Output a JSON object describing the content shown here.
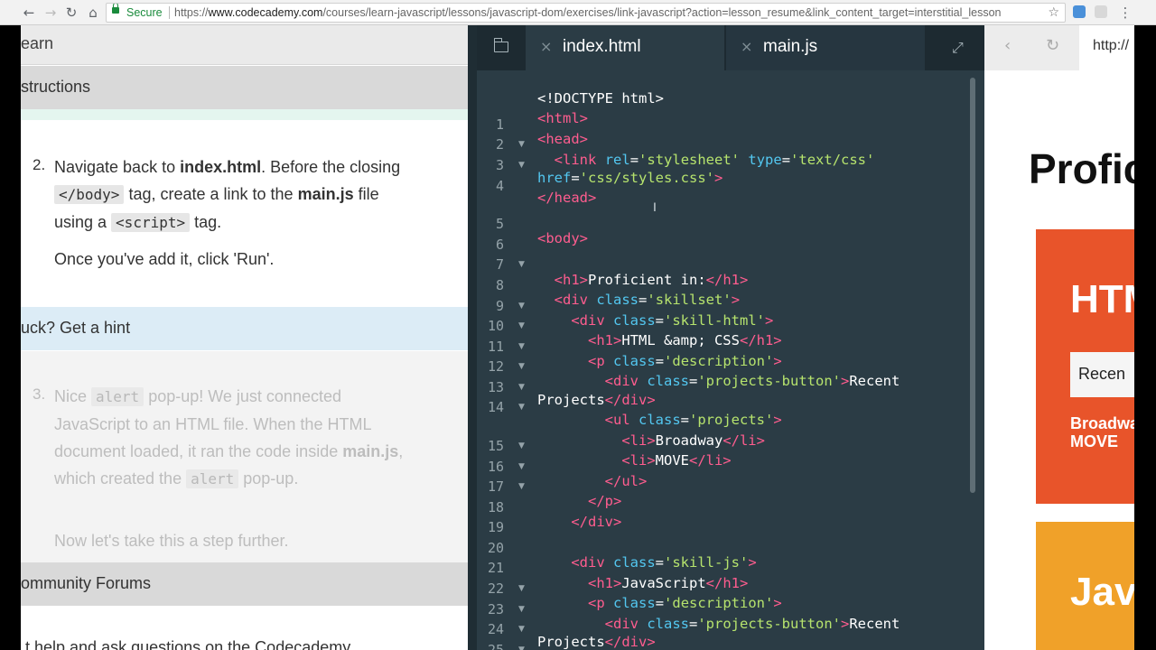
{
  "browser": {
    "back_icon": "arrow-left-icon",
    "forward_icon": "arrow-right-icon",
    "reload_icon": "reload-icon",
    "home_icon": "home-icon",
    "secure_label": "Secure",
    "url_scheme": "https://",
    "url_host": "www.codecademy.com",
    "url_path": "/courses/learn-javascript/lessons/javascript-dom/exercises/link-javascript?action=lesson_resume&link_content_target=interstitial_lesson"
  },
  "lesson": {
    "learn_label": "earn",
    "instructions_label": "structions",
    "step2": {
      "number": "2.",
      "text_a": "Navigate back to ",
      "bold_a": "index.html",
      "text_b": ". Before the closing",
      "code_a": "</body>",
      "text_c": " tag, create a link to the ",
      "bold_b": "main.js",
      "text_d": " file",
      "text_e": "using a ",
      "code_b": "<script>",
      "text_f": " tag.",
      "note": "Once you've add it, click 'Run'."
    },
    "hint_label": "uck? Get a hint",
    "step3": {
      "number": "3.",
      "text_a": "Nice ",
      "code_a": "alert",
      "text_b": " pop-up! We just connected",
      "line2": "JavaScript to an HTML file. When the HTML",
      "text_c": "document loaded, it ran the code inside ",
      "bold_a": "main.js",
      "text_d": ",",
      "text_e": "which created the ",
      "code_b": "alert",
      "text_f": " pop-up.",
      "note": "Now let's take this a step further."
    },
    "forums_label": "ommunity Forums",
    "forums_text": "t help and ask questions on the Codecademy"
  },
  "editor": {
    "tabs": [
      {
        "label": "index.html",
        "active": true
      },
      {
        "label": "main.js",
        "active": false
      }
    ],
    "close_glyph": "×",
    "line_numbers": [
      "1",
      "2",
      "3",
      "4",
      "5",
      "6",
      "7",
      "8",
      "9",
      "10",
      "11",
      "12",
      "13",
      "14",
      "15",
      "16",
      "17",
      "18",
      "19",
      "20",
      "21",
      "22",
      "23",
      "24",
      "25"
    ]
  },
  "preview": {
    "url_text": "http://",
    "heading": "Profic",
    "card_html_title": "HTM",
    "button_label": "Recen",
    "list_items": [
      "Broadwa",
      "MOVE"
    ],
    "card_js_title": "Jav"
  },
  "colors": {
    "editor_bg": "#2b3c45",
    "tag": "#ff5d8f",
    "attr": "#53c7f0",
    "string": "#b6e36d",
    "html_card": "#e8542a",
    "js_card": "#f0a129",
    "secure_green": "#1a8b3c"
  }
}
